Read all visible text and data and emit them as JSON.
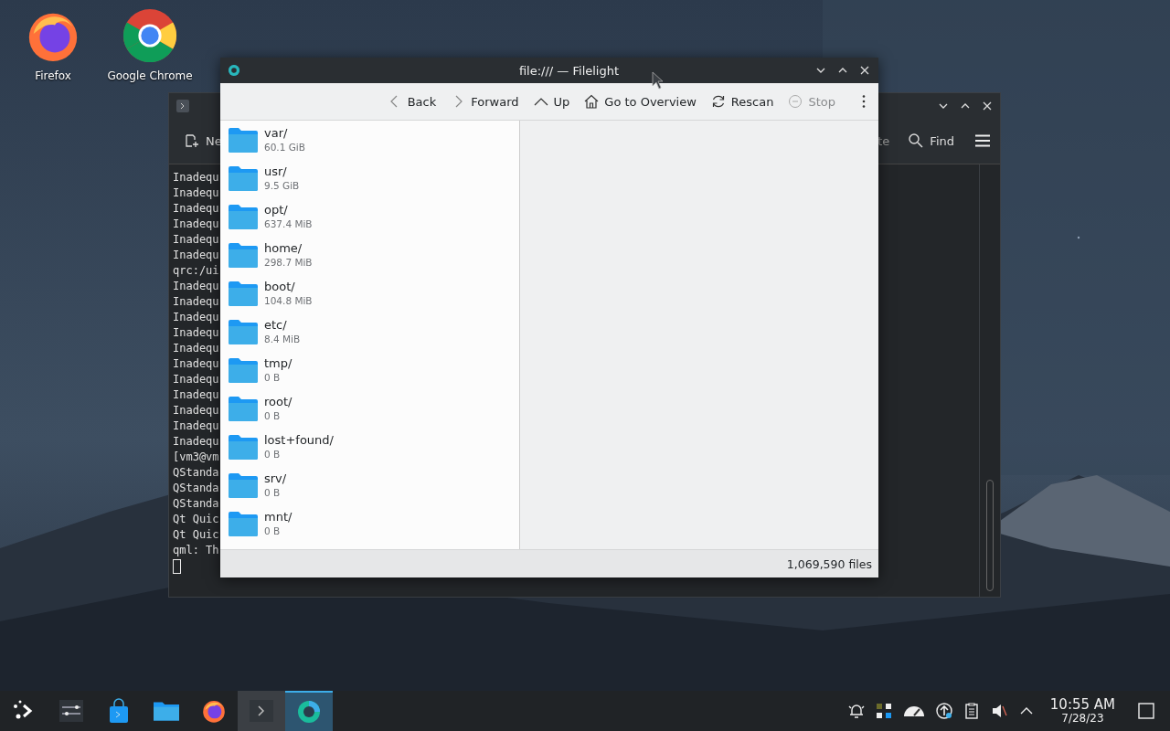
{
  "desktop_icons": [
    {
      "label": "Firefox",
      "kind": "firefox"
    },
    {
      "label": "Google Chrome",
      "kind": "chrome"
    }
  ],
  "terminal_window": {
    "toolbar": {
      "new_tab_label": "Ne",
      "cut_label": "te",
      "find_label": "Find"
    },
    "lines": [
      "Inadequ",
      "Inadequ",
      "Inadequ",
      "Inadequ",
      "Inadequ",
      "Inadequ",
      "qrc:/ui",
      "Inadequ",
      "Inadequ",
      "Inadequ",
      "Inadequ",
      "Inadequ",
      "Inadequ",
      "Inadequ",
      "Inadequ",
      "Inadequ",
      "Inadequ",
      "Inadequ",
      "[vm3@vm",
      "QStanda",
      "QStanda",
      "QStanda",
      "Qt Quic",
      "Qt Quic",
      "qml: Th"
    ]
  },
  "filelight_window": {
    "title": "file:/// — Filelight",
    "toolbar": [
      {
        "label": "Back",
        "kind": "back",
        "disabled": false
      },
      {
        "label": "Forward",
        "kind": "forward",
        "disabled": false
      },
      {
        "label": "Up",
        "kind": "up",
        "disabled": false
      },
      {
        "label": "Go to Overview",
        "kind": "home",
        "disabled": false
      },
      {
        "label": "Rescan",
        "kind": "rescan",
        "disabled": false
      },
      {
        "label": "Stop",
        "kind": "stop",
        "disabled": true
      }
    ],
    "items": [
      {
        "name": "var/",
        "size": "60.1 GiB"
      },
      {
        "name": "usr/",
        "size": "9.5 GiB"
      },
      {
        "name": "opt/",
        "size": "637.4 MiB"
      },
      {
        "name": "home/",
        "size": "298.7 MiB"
      },
      {
        "name": "boot/",
        "size": "104.8 MiB"
      },
      {
        "name": "etc/",
        "size": "8.4 MiB"
      },
      {
        "name": "tmp/",
        "size": "0 B"
      },
      {
        "name": "root/",
        "size": "0 B"
      },
      {
        "name": "lost+found/",
        "size": "0 B"
      },
      {
        "name": "srv/",
        "size": "0 B"
      },
      {
        "name": "mnt/",
        "size": "0 B"
      }
    ],
    "status": "1,069,590 files"
  },
  "taskbar": {
    "tasks": [
      {
        "kind": "launcher",
        "selected": false,
        "running": false
      },
      {
        "kind": "settings",
        "selected": false,
        "running": false
      },
      {
        "kind": "store",
        "selected": false,
        "running": false
      },
      {
        "kind": "files",
        "selected": false,
        "running": false
      },
      {
        "kind": "firefox",
        "selected": false,
        "running": false
      },
      {
        "kind": "terminal",
        "selected": false,
        "running": true
      },
      {
        "kind": "filelight",
        "selected": true,
        "running": true
      }
    ],
    "clock": {
      "time": "10:55 AM",
      "date": "7/28/23"
    }
  }
}
